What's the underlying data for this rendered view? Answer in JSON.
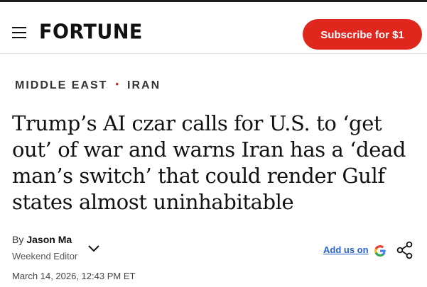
{
  "header": {
    "logo": "FORTUNE",
    "subscribe_label": "Subscribe for $1"
  },
  "breadcrumb": {
    "section": "MIDDLE EAST",
    "separator": "•",
    "topic": "IRAN"
  },
  "article": {
    "headline": "Trump’s AI czar calls for U.S. to ‘get out’ of war and warns Iran has a ‘dead man’s switch’ that could render Gulf states almost uninhabitable",
    "by_prefix": "By",
    "author": "Jason Ma",
    "author_role": "Weekend Editor",
    "add_us_label": "Add us on",
    "date": "March 14, 2026, 12:43 PM ET"
  },
  "colors": {
    "accent": "#e0271e",
    "link": "#2a62c9"
  },
  "icons": [
    "menu-icon",
    "chevron-down-icon",
    "google-icon",
    "share-icon"
  ]
}
